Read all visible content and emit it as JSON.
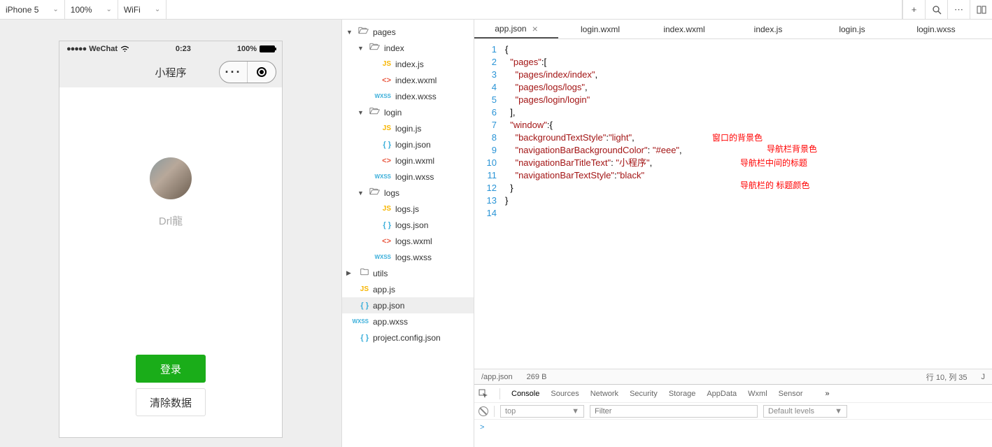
{
  "toolbar": {
    "device": "iPhone 5",
    "zoom": "100%",
    "network": "WiFi"
  },
  "phone": {
    "carrier": "WeChat",
    "time": "0:23",
    "battery": "100%",
    "nav_title": "小程序",
    "nickname": "Drl龍",
    "login_btn": "登录",
    "clear_btn": "清除数据"
  },
  "tree": [
    {
      "depth": 0,
      "open": true,
      "icon": "folder",
      "label": "pages"
    },
    {
      "depth": 1,
      "open": true,
      "icon": "folder",
      "label": "index"
    },
    {
      "depth": 2,
      "icon": "js",
      "label": "index.js"
    },
    {
      "depth": 2,
      "icon": "wxml",
      "label": "index.wxml"
    },
    {
      "depth": 2,
      "icon": "wxss",
      "label": "index.wxss"
    },
    {
      "depth": 1,
      "open": true,
      "icon": "folder",
      "label": "login"
    },
    {
      "depth": 2,
      "icon": "js",
      "label": "login.js"
    },
    {
      "depth": 2,
      "icon": "json",
      "label": "login.json"
    },
    {
      "depth": 2,
      "icon": "wxml",
      "label": "login.wxml"
    },
    {
      "depth": 2,
      "icon": "wxss",
      "label": "login.wxss"
    },
    {
      "depth": 1,
      "open": true,
      "icon": "folder",
      "label": "logs"
    },
    {
      "depth": 2,
      "icon": "js",
      "label": "logs.js"
    },
    {
      "depth": 2,
      "icon": "json",
      "label": "logs.json"
    },
    {
      "depth": 2,
      "icon": "wxml",
      "label": "logs.wxml"
    },
    {
      "depth": 2,
      "icon": "wxss",
      "label": "logs.wxss"
    },
    {
      "depth": 0,
      "open": false,
      "icon": "folder-closed",
      "label": "utils"
    },
    {
      "depth": 0,
      "icon": "js",
      "label": "app.js"
    },
    {
      "depth": 0,
      "icon": "json",
      "label": "app.json",
      "selected": true
    },
    {
      "depth": 0,
      "icon": "wxss",
      "label": "app.wxss"
    },
    {
      "depth": 0,
      "icon": "json",
      "label": "project.config.json"
    }
  ],
  "editor_tabs": [
    {
      "label": "app.json",
      "active": true,
      "closeable": true
    },
    {
      "label": "login.wxml"
    },
    {
      "label": "index.wxml"
    },
    {
      "label": "index.js"
    },
    {
      "label": "login.js"
    },
    {
      "label": "login.wxss"
    }
  ],
  "code": {
    "lines": 14,
    "content": {
      "pages_key": "\"pages\"",
      "p1": "\"pages/index/index\"",
      "p2": "\"pages/logs/logs\"",
      "p3": "\"pages/login/login\"",
      "window_key": "\"window\"",
      "k1": "\"backgroundTextStyle\"",
      "v1": "\"light\"",
      "k2": "\"navigationBarBackgroundColor\"",
      "v2": "\"#eee\"",
      "k3": "\"navigationBarTitleText\"",
      "v3": "\"小程序\"",
      "k4": "\"navigationBarTextStyle\"",
      "v4": "\"black\""
    },
    "annotations": {
      "a1": "窗口的背景色",
      "a2": "导航栏背景色",
      "a3": "导航栏中间的标题",
      "a4": "导航栏的 标题颜色"
    }
  },
  "status": {
    "path": "/app.json",
    "size": "269 B",
    "pos": "行 10, 列 35",
    "lang": "J"
  },
  "devtools": {
    "tabs": [
      "Console",
      "Sources",
      "Network",
      "Security",
      "Storage",
      "AppData",
      "Wxml",
      "Sensor"
    ],
    "scope": "top",
    "filter_placeholder": "Filter",
    "levels": "Default levels",
    "prompt": ">"
  }
}
